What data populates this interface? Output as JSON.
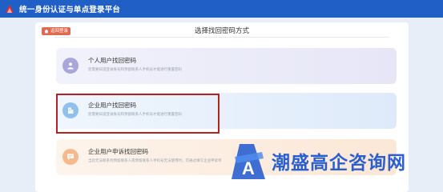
{
  "header": {
    "title": "统一身份认证与单点登录平台"
  },
  "panel": {
    "back_label": "返回登录",
    "page_title": "选择找回密码方式"
  },
  "cards": [
    {
      "title": "个人用户找回密码",
      "desc": "您需要知道登录账号和预留联系人手机号才能进行重置密码"
    },
    {
      "title": "企业用户找回密码",
      "desc": "您需要知道登录账号和预留联系人手机号才能进行重置密码"
    },
    {
      "title": "企业用户申诉找回密码",
      "desc": "当您无法联系到预留联系人或预留联系人手机号无法使用时，可通过填写企业申诉单"
    }
  ],
  "watermark": {
    "text": "潮盛高企咨询网",
    "logo_letter": "A"
  },
  "colors": {
    "topbar": "#1f5fc6",
    "highlight": "#b3241f",
    "back_button": "#e06a50",
    "watermark": "#2a5fd0"
  },
  "icons": {
    "logo": "red-emblem-icon",
    "back": "home-icon",
    "personal": "user-icon",
    "enterprise": "building-icon",
    "appeal": "chat-bubble-icon"
  }
}
